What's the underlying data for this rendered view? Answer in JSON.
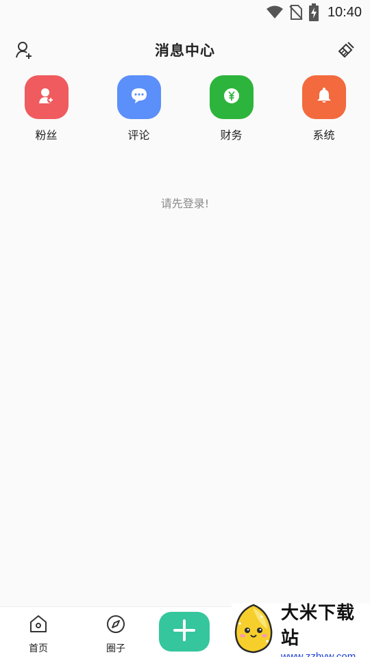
{
  "status_bar": {
    "time": "10:40",
    "icons": [
      "wifi-icon",
      "no-sim-icon",
      "battery-charging-icon"
    ]
  },
  "header": {
    "title": "消息中心",
    "left_icon": "add-user-icon",
    "right_icon": "clear-brush-icon"
  },
  "categories": [
    {
      "label": "粉丝",
      "icon": "user-add-icon",
      "color": "#ef5b5e"
    },
    {
      "label": "评论",
      "icon": "chat-bubble-icon",
      "color": "#5b8ff9"
    },
    {
      "label": "财务",
      "icon": "yuan-icon",
      "color": "#2db43c"
    },
    {
      "label": "系统",
      "icon": "bell-icon",
      "color": "#f26a3d"
    }
  ],
  "empty_message": "请先登录!",
  "tabbar": {
    "tabs": [
      {
        "label": "首页",
        "icon": "home-icon"
      },
      {
        "label": "圈子",
        "icon": "compass-icon"
      }
    ],
    "add_icon": "plus-icon",
    "add_color": "#35c69e"
  },
  "watermark": {
    "title": "大米下载站",
    "url": "www.zzhyw.com"
  }
}
